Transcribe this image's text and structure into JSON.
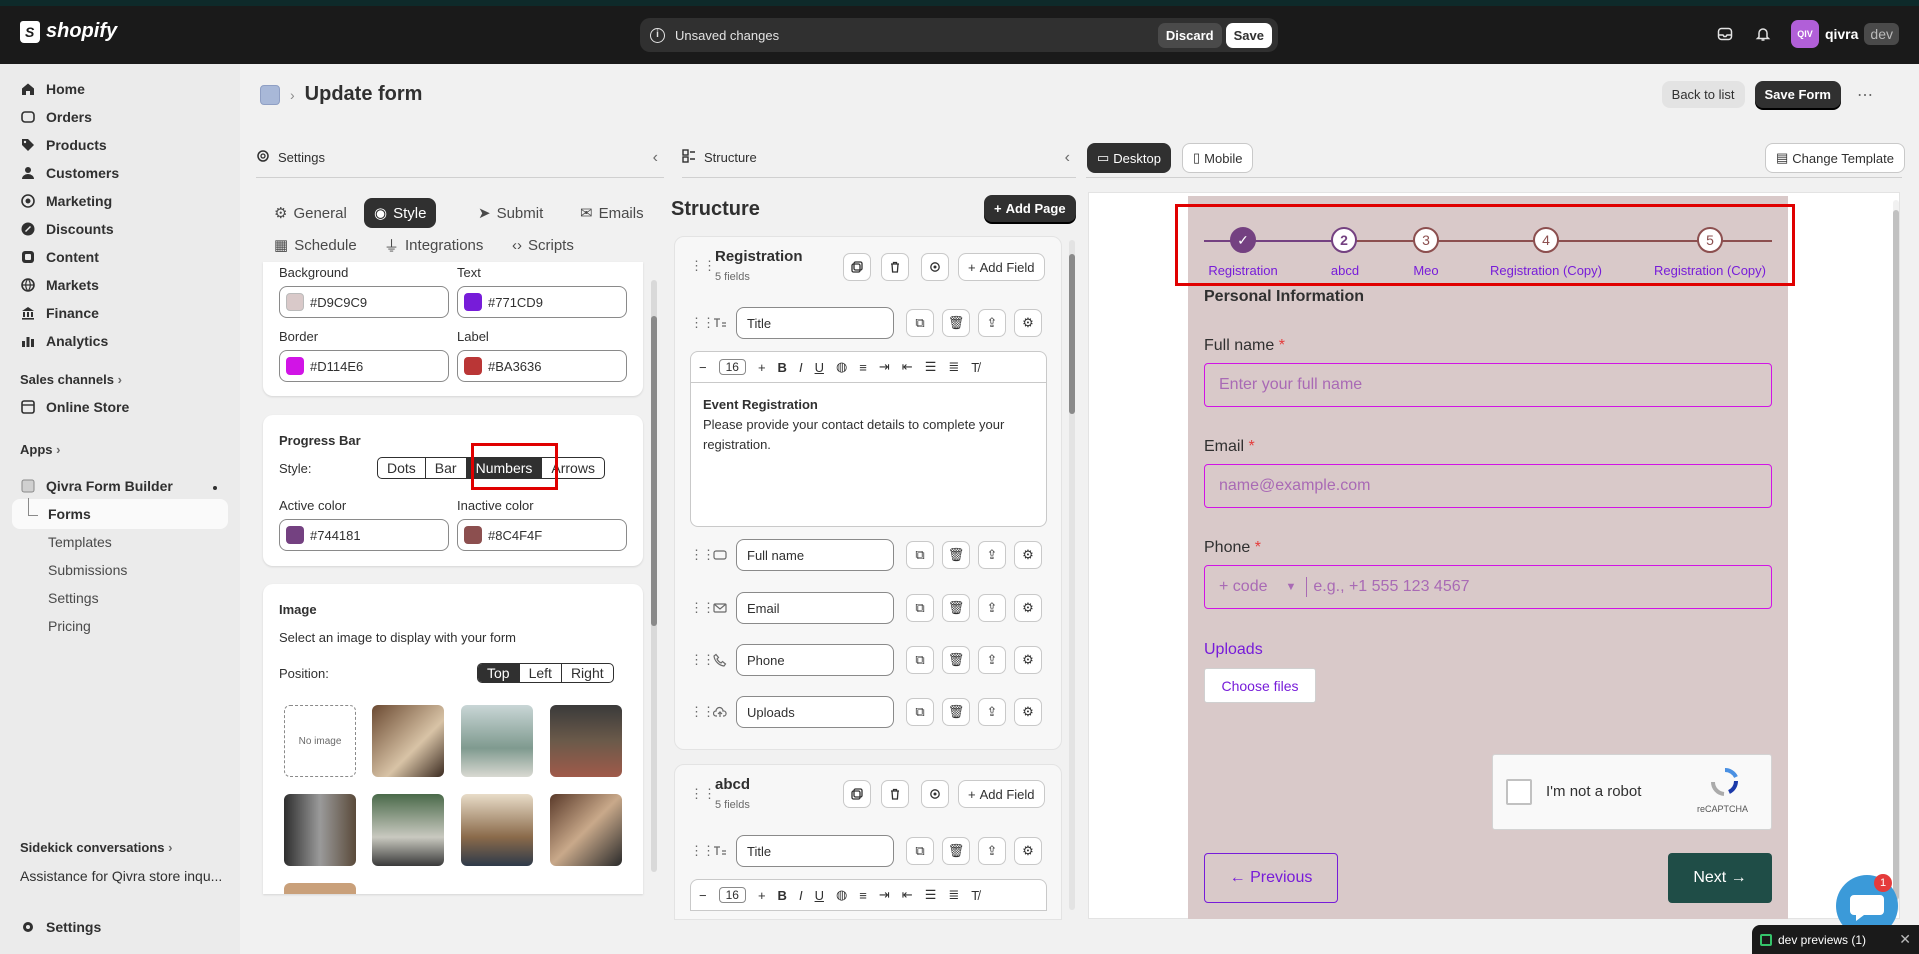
{
  "topbar": {
    "brand": "shopify",
    "unsaved_text": "Unsaved changes",
    "discard": "Discard",
    "save": "Save",
    "store_initials": "QIV",
    "store_name": "qivra",
    "store_badge": "dev"
  },
  "sidebar": {
    "items": [
      {
        "label": "Home",
        "icon": "home-icon"
      },
      {
        "label": "Orders",
        "icon": "orders-icon"
      },
      {
        "label": "Products",
        "icon": "tag-icon"
      },
      {
        "label": "Customers",
        "icon": "person-icon"
      },
      {
        "label": "Marketing",
        "icon": "target-icon"
      },
      {
        "label": "Discounts",
        "icon": "discount-icon"
      },
      {
        "label": "Content",
        "icon": "content-icon"
      },
      {
        "label": "Markets",
        "icon": "globe-icon"
      },
      {
        "label": "Finance",
        "icon": "bank-icon"
      },
      {
        "label": "Analytics",
        "icon": "chart-icon"
      }
    ],
    "sales_channels": "Sales channels",
    "online_store": "Online Store",
    "apps": "Apps",
    "app_name": "Qivra Form Builder",
    "app_sub": [
      "Forms",
      "Templates",
      "Submissions",
      "Settings",
      "Pricing"
    ],
    "sidekick": "Sidekick conversations",
    "conversation": "Assistance for Qivra store inqu...",
    "settings": "Settings"
  },
  "page": {
    "title": "Update form",
    "back": "Back to list",
    "save_form": "Save Form",
    "more": "⋯"
  },
  "settings_panel": {
    "title": "Settings",
    "tabs": [
      "General",
      "Style",
      "Submit",
      "Emails",
      "Schedule",
      "Integrations",
      "Scripts"
    ],
    "active_tab": "Style",
    "colors": {
      "background_label": "Background",
      "background_value": "#D9C9C9",
      "text_label": "Text",
      "text_value": "#771CD9",
      "border_label": "Border",
      "border_value": "#D114E6",
      "label_label": "Label",
      "label_value": "#BA3636"
    },
    "progress": {
      "title": "Progress Bar",
      "style_label": "Style:",
      "options": [
        "Dots",
        "Bar",
        "Numbers",
        "Arrows"
      ],
      "selected": "Numbers",
      "active_label": "Active color",
      "active_value": "#744181",
      "inactive_label": "Inactive color",
      "inactive_value": "#8C4F4F"
    },
    "image": {
      "title": "Image",
      "desc": "Select an image to display with your form",
      "position_label": "Position:",
      "positions": [
        "Top",
        "Left",
        "Right"
      ],
      "selected": "Top",
      "no_image": "No image"
    }
  },
  "structure_panel": {
    "header": "Structure",
    "title": "Structure",
    "add_page": "Add Page",
    "add_field": "Add Field",
    "pages": [
      {
        "name": "Registration",
        "count": "5 fields",
        "fields": [
          "Title",
          "Full name",
          "Email",
          "Phone",
          "Uploads"
        ],
        "font_size": "16",
        "editor_heading": "Event Registration",
        "editor_body": "Please provide your contact details to complete your registration."
      },
      {
        "name": "abcd",
        "count": "5 fields",
        "fields": [
          "Title"
        ],
        "font_size": "16"
      }
    ]
  },
  "preview": {
    "desktop": "Desktop",
    "mobile": "Mobile",
    "change_template": "Change Template",
    "steps": [
      {
        "num": "✓",
        "label": "Registration",
        "state": "done"
      },
      {
        "num": "2",
        "label": "abcd",
        "state": "active"
      },
      {
        "num": "3",
        "label": "Meo",
        "state": "inactive"
      },
      {
        "num": "4",
        "label": "Registration (Copy)",
        "state": "inactive"
      },
      {
        "num": "5",
        "label": "Registration (Copy)",
        "state": "inactive"
      }
    ],
    "section": "Personal Information",
    "full_name_label": "Full name",
    "full_name_placeholder": "Enter your full name",
    "email_label": "Email",
    "email_placeholder": "name@example.com",
    "phone_label": "Phone",
    "phone_code": "+ code",
    "phone_placeholder": "e.g., +1 555 123 4567",
    "req": "*",
    "uploads_label": "Uploads",
    "choose_files": "Choose files",
    "captcha_text": "I'm not a robot",
    "captcha_brand": "reCAPTCHA",
    "prev": "← Previous",
    "next": "Next →"
  },
  "dev_preview": "dev previews (1)",
  "chat_badge": "1",
  "colors": {
    "accent_dark": "#303030",
    "highlight": "#e00000",
    "next_button": "#1f4d47"
  }
}
